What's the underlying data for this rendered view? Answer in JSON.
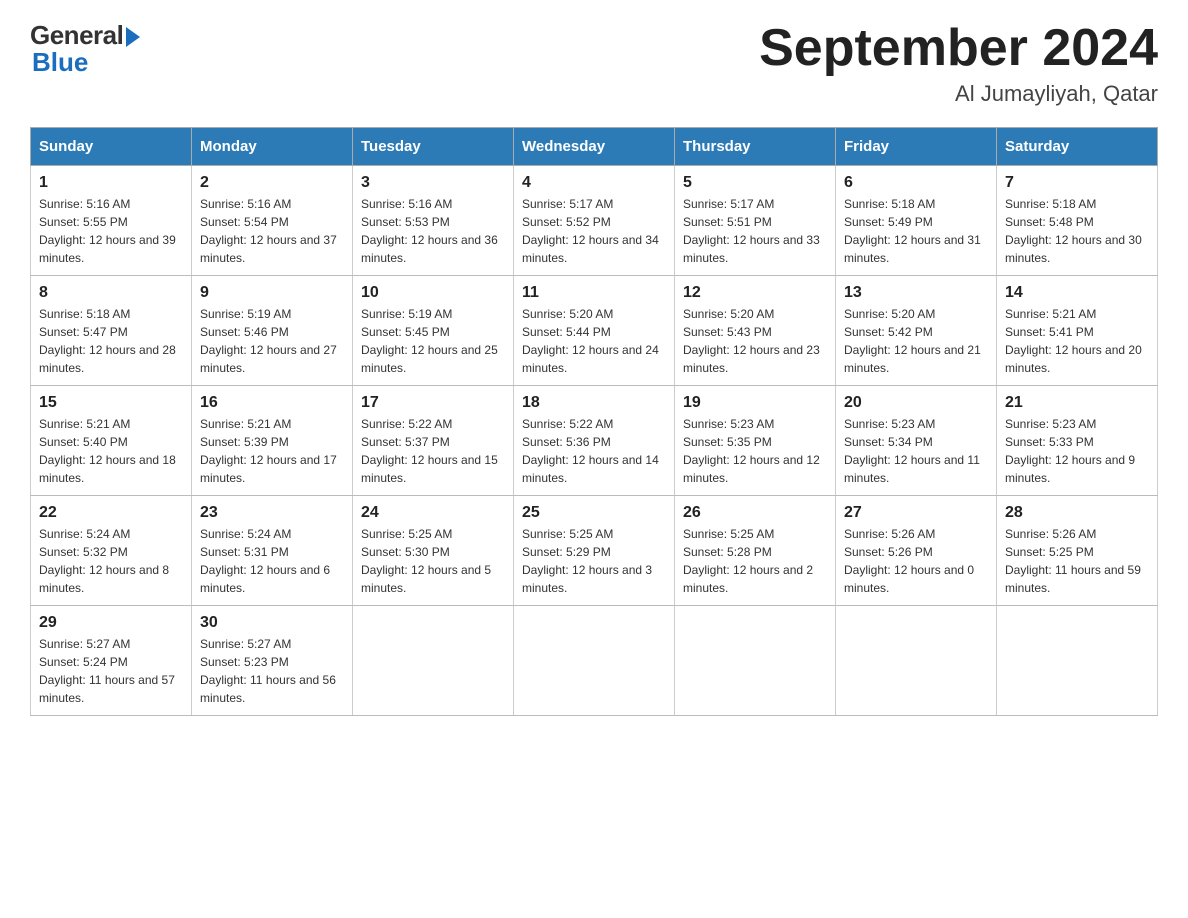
{
  "logo": {
    "general": "General",
    "blue": "Blue"
  },
  "title": "September 2024",
  "location": "Al Jumayliyah, Qatar",
  "weekdays": [
    "Sunday",
    "Monday",
    "Tuesday",
    "Wednesday",
    "Thursday",
    "Friday",
    "Saturday"
  ],
  "weeks": [
    [
      {
        "day": "1",
        "sunrise": "Sunrise: 5:16 AM",
        "sunset": "Sunset: 5:55 PM",
        "daylight": "Daylight: 12 hours and 39 minutes."
      },
      {
        "day": "2",
        "sunrise": "Sunrise: 5:16 AM",
        "sunset": "Sunset: 5:54 PM",
        "daylight": "Daylight: 12 hours and 37 minutes."
      },
      {
        "day": "3",
        "sunrise": "Sunrise: 5:16 AM",
        "sunset": "Sunset: 5:53 PM",
        "daylight": "Daylight: 12 hours and 36 minutes."
      },
      {
        "day": "4",
        "sunrise": "Sunrise: 5:17 AM",
        "sunset": "Sunset: 5:52 PM",
        "daylight": "Daylight: 12 hours and 34 minutes."
      },
      {
        "day": "5",
        "sunrise": "Sunrise: 5:17 AM",
        "sunset": "Sunset: 5:51 PM",
        "daylight": "Daylight: 12 hours and 33 minutes."
      },
      {
        "day": "6",
        "sunrise": "Sunrise: 5:18 AM",
        "sunset": "Sunset: 5:49 PM",
        "daylight": "Daylight: 12 hours and 31 minutes."
      },
      {
        "day": "7",
        "sunrise": "Sunrise: 5:18 AM",
        "sunset": "Sunset: 5:48 PM",
        "daylight": "Daylight: 12 hours and 30 minutes."
      }
    ],
    [
      {
        "day": "8",
        "sunrise": "Sunrise: 5:18 AM",
        "sunset": "Sunset: 5:47 PM",
        "daylight": "Daylight: 12 hours and 28 minutes."
      },
      {
        "day": "9",
        "sunrise": "Sunrise: 5:19 AM",
        "sunset": "Sunset: 5:46 PM",
        "daylight": "Daylight: 12 hours and 27 minutes."
      },
      {
        "day": "10",
        "sunrise": "Sunrise: 5:19 AM",
        "sunset": "Sunset: 5:45 PM",
        "daylight": "Daylight: 12 hours and 25 minutes."
      },
      {
        "day": "11",
        "sunrise": "Sunrise: 5:20 AM",
        "sunset": "Sunset: 5:44 PM",
        "daylight": "Daylight: 12 hours and 24 minutes."
      },
      {
        "day": "12",
        "sunrise": "Sunrise: 5:20 AM",
        "sunset": "Sunset: 5:43 PM",
        "daylight": "Daylight: 12 hours and 23 minutes."
      },
      {
        "day": "13",
        "sunrise": "Sunrise: 5:20 AM",
        "sunset": "Sunset: 5:42 PM",
        "daylight": "Daylight: 12 hours and 21 minutes."
      },
      {
        "day": "14",
        "sunrise": "Sunrise: 5:21 AM",
        "sunset": "Sunset: 5:41 PM",
        "daylight": "Daylight: 12 hours and 20 minutes."
      }
    ],
    [
      {
        "day": "15",
        "sunrise": "Sunrise: 5:21 AM",
        "sunset": "Sunset: 5:40 PM",
        "daylight": "Daylight: 12 hours and 18 minutes."
      },
      {
        "day": "16",
        "sunrise": "Sunrise: 5:21 AM",
        "sunset": "Sunset: 5:39 PM",
        "daylight": "Daylight: 12 hours and 17 minutes."
      },
      {
        "day": "17",
        "sunrise": "Sunrise: 5:22 AM",
        "sunset": "Sunset: 5:37 PM",
        "daylight": "Daylight: 12 hours and 15 minutes."
      },
      {
        "day": "18",
        "sunrise": "Sunrise: 5:22 AM",
        "sunset": "Sunset: 5:36 PM",
        "daylight": "Daylight: 12 hours and 14 minutes."
      },
      {
        "day": "19",
        "sunrise": "Sunrise: 5:23 AM",
        "sunset": "Sunset: 5:35 PM",
        "daylight": "Daylight: 12 hours and 12 minutes."
      },
      {
        "day": "20",
        "sunrise": "Sunrise: 5:23 AM",
        "sunset": "Sunset: 5:34 PM",
        "daylight": "Daylight: 12 hours and 11 minutes."
      },
      {
        "day": "21",
        "sunrise": "Sunrise: 5:23 AM",
        "sunset": "Sunset: 5:33 PM",
        "daylight": "Daylight: 12 hours and 9 minutes."
      }
    ],
    [
      {
        "day": "22",
        "sunrise": "Sunrise: 5:24 AM",
        "sunset": "Sunset: 5:32 PM",
        "daylight": "Daylight: 12 hours and 8 minutes."
      },
      {
        "day": "23",
        "sunrise": "Sunrise: 5:24 AM",
        "sunset": "Sunset: 5:31 PM",
        "daylight": "Daylight: 12 hours and 6 minutes."
      },
      {
        "day": "24",
        "sunrise": "Sunrise: 5:25 AM",
        "sunset": "Sunset: 5:30 PM",
        "daylight": "Daylight: 12 hours and 5 minutes."
      },
      {
        "day": "25",
        "sunrise": "Sunrise: 5:25 AM",
        "sunset": "Sunset: 5:29 PM",
        "daylight": "Daylight: 12 hours and 3 minutes."
      },
      {
        "day": "26",
        "sunrise": "Sunrise: 5:25 AM",
        "sunset": "Sunset: 5:28 PM",
        "daylight": "Daylight: 12 hours and 2 minutes."
      },
      {
        "day": "27",
        "sunrise": "Sunrise: 5:26 AM",
        "sunset": "Sunset: 5:26 PM",
        "daylight": "Daylight: 12 hours and 0 minutes."
      },
      {
        "day": "28",
        "sunrise": "Sunrise: 5:26 AM",
        "sunset": "Sunset: 5:25 PM",
        "daylight": "Daylight: 11 hours and 59 minutes."
      }
    ],
    [
      {
        "day": "29",
        "sunrise": "Sunrise: 5:27 AM",
        "sunset": "Sunset: 5:24 PM",
        "daylight": "Daylight: 11 hours and 57 minutes."
      },
      {
        "day": "30",
        "sunrise": "Sunrise: 5:27 AM",
        "sunset": "Sunset: 5:23 PM",
        "daylight": "Daylight: 11 hours and 56 minutes."
      },
      null,
      null,
      null,
      null,
      null
    ]
  ]
}
